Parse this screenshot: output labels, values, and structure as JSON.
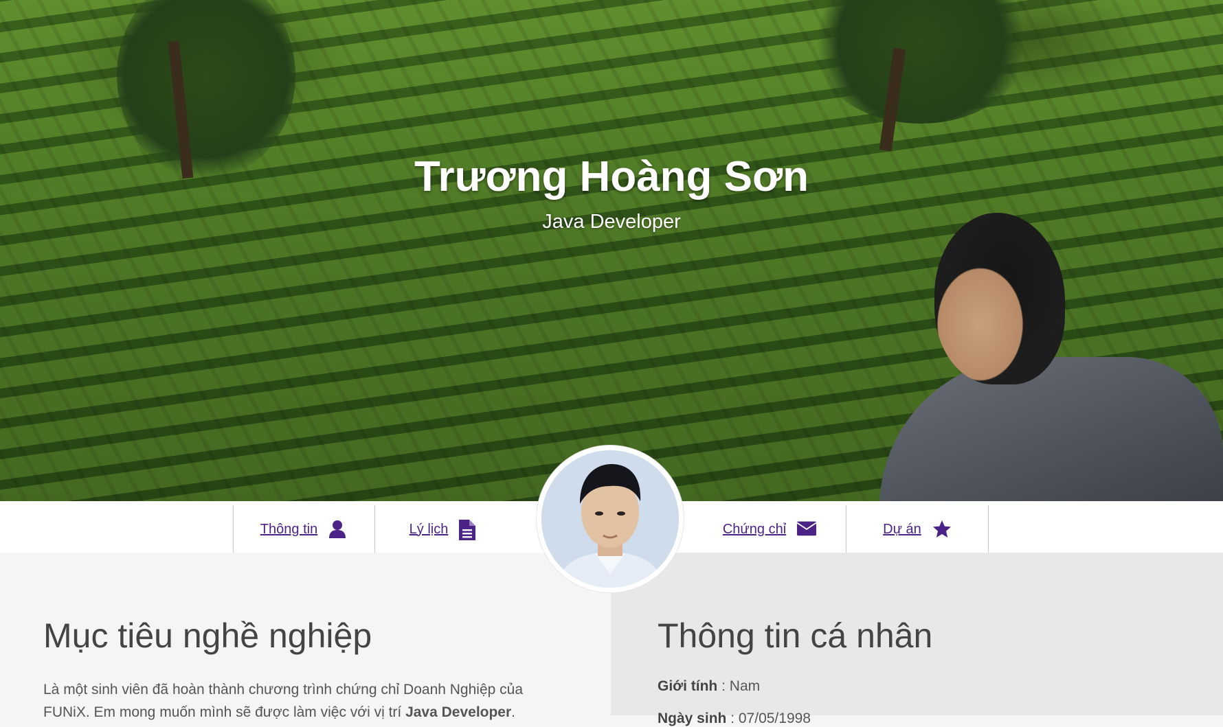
{
  "hero": {
    "name": "Trương Hoàng Sơn",
    "title": "Java Developer"
  },
  "nav": {
    "items": [
      {
        "label": "Thông tin",
        "icon": "user-icon"
      },
      {
        "label": "Lý lịch",
        "icon": "document-icon"
      },
      {
        "label": "Chứng chỉ",
        "icon": "envelope-icon"
      },
      {
        "label": "Dự án",
        "icon": "star-icon"
      }
    ]
  },
  "career": {
    "heading": "Mục tiêu nghề nghiệp",
    "text_before": "Là một sinh viên đã hoàn thành chương trình chứng chỉ Doanh Nghiệp của FUNiX. Em mong muốn mình sẽ được làm việc với vị trí ",
    "highlight": "Java Developer",
    "text_after": "."
  },
  "personal": {
    "heading": "Thông tin cá nhân",
    "gender_label": "Giới tính",
    "gender_value": "Nam",
    "birth_label": "Ngày sinh",
    "birth_value": "07/05/1998"
  },
  "colors": {
    "accent": "#4b2387",
    "text": "#555555",
    "heading": "#444444"
  }
}
